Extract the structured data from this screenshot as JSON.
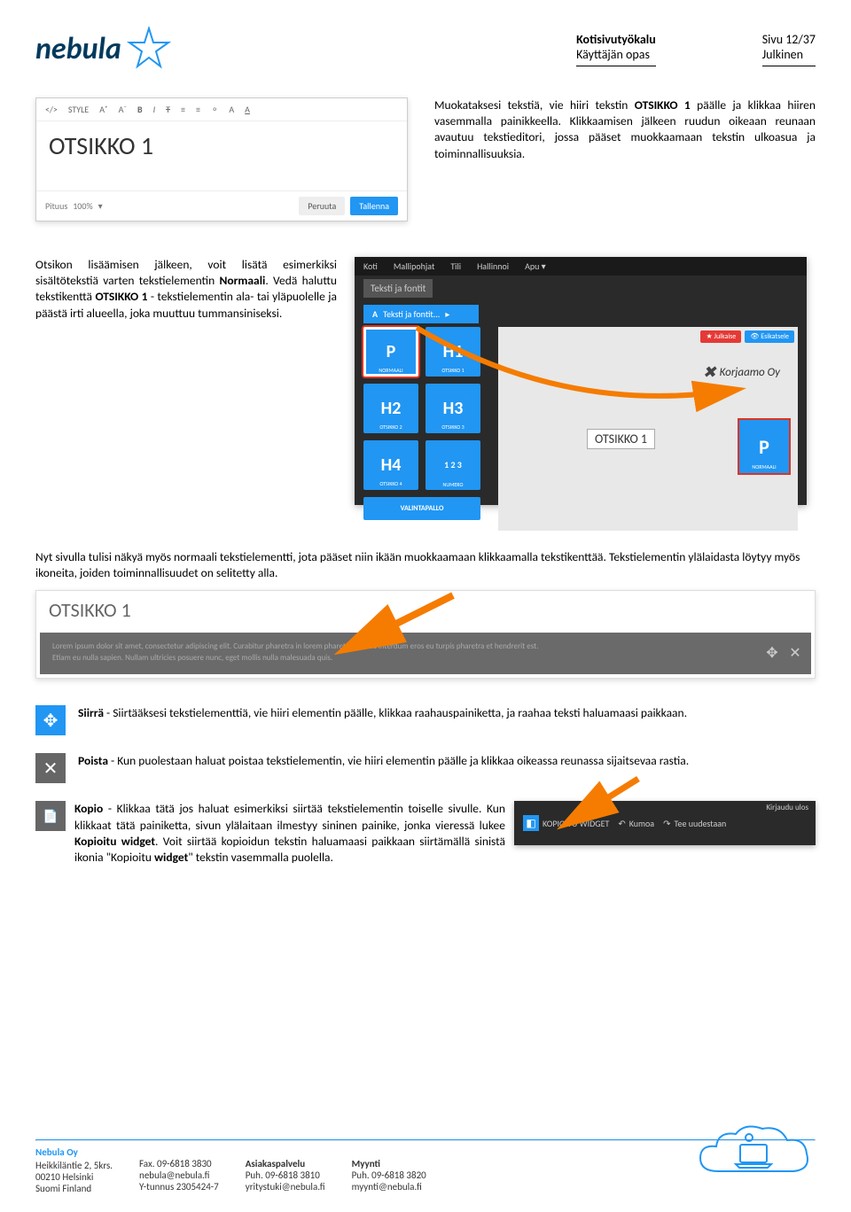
{
  "header": {
    "logo_text": "nebula",
    "doc_title": "Kotisivutyökalu",
    "doc_subtitle": "Käyttäjän opas",
    "page_info": "Sivu 12/37",
    "visibility": "Julkinen"
  },
  "editor": {
    "toolbar": {
      "style": "STYLE",
      "items": [
        "</>",
        "A⁺",
        "A⁻",
        "B",
        "I",
        "T",
        "≡",
        "≡",
        "⚬",
        "A",
        "A"
      ]
    },
    "body": "OTSIKKO 1",
    "length_label": "Pituus",
    "length_value": "100%",
    "cancel": "Peruuta",
    "save": "Tallenna"
  },
  "sec1_text": {
    "p1a": "Muokataksesi tekstiä, vie hiiri tekstin ",
    "p1b": "OTSIKKO 1",
    "p1c": " päälle ja klikkaa hiiren vasemmalla painikkeella. Klikkaamisen jälkeen ruudun oikeaan reunaan avautuu tekstieditori, jossa pääset muokkaamaan tekstin ulkoasua ja toiminnallisuuksia."
  },
  "sec2_text": {
    "p1a": "Otsikon lisäämisen jälkeen, voit lisätä esimerkiksi sisältötekstiä varten tekstielementin ",
    "p1b": "Normaali",
    "p1c": ". Vedä haluttu tekstikenttä ",
    "p1d": "OTSIKKO 1",
    "p1e": " - tekstielementin ala- tai yläpuolelle ja päästä irti alueella, joka muuttuu tummansiniseksi."
  },
  "panel": {
    "nav": [
      "Koti",
      "Mallipohjat",
      "Tili",
      "Hallinnoi",
      "Apu ▾"
    ],
    "tag": "Teksti ja fontit",
    "sidebar_label": "Teksti ja fontit...",
    "tiles": [
      {
        "big": "P",
        "sub": "NORMAALI"
      },
      {
        "big": "H1",
        "sub": "OTSIKKO 1"
      },
      {
        "big": "H2",
        "sub": "OTSIKKO 2"
      },
      {
        "big": "H3",
        "sub": "OTSIKKO 3"
      },
      {
        "big": "H4",
        "sub": "OTSIKKO 4"
      },
      {
        "big": "1 2 3",
        "sub": "NUMERO"
      }
    ],
    "valintapallo": "VALINTAPALLO",
    "preview": {
      "julkaise": "★ Julkaise",
      "esikatsele": "👁 Esikatsele",
      "brand": "Korjaamo Oy",
      "otsikko": "OTSIKKO 1",
      "tile_p_big": "P",
      "tile_p_sub": "NORMAALI"
    }
  },
  "sec3_text": "Nyt sivulla tulisi näkyä myös normaali tekstielementti, jota pääset niin ikään muokkaamaan klikkaamalla tekstikenttää. Tekstielementin ylälaidasta löytyy myös ikoneita, joiden toiminnallisuudet on selitetty alla.",
  "wide": {
    "title": "OTSIKKO 1",
    "lorem1": "Lorem ipsum dolor sit amet, consectetur adipiscing elit. Curabitur pharetra in lorem pharetra. Donec interdum eros eu turpis pharetra et hendrerit est.",
    "lorem2": "Etiam eu nulla sapien. Nullam ultricies posuere nunc, eget mollis nulla malesuada quis."
  },
  "icons": {
    "siirra": {
      "title": "Siirrä",
      "text": " - Siirtääksesi tekstielementtiä, vie hiiri elementin päälle, klikkaa raahauspainiketta, ja raahaa teksti haluamaasi paikkaan."
    },
    "poista": {
      "title": "Poista",
      "text": " - Kun puolestaan haluat poistaa tekstielementin, vie hiiri elementin päälle ja klikkaa oikeassa reunassa sijaitsevaa rastia."
    },
    "kopio": {
      "title": "Kopio",
      "text1": " - Klikkaa tätä jos haluat esimerkiksi siirtää tekstielementin toiselle sivulle. Kun klikkaat tätä painiketta, sivun ylälaitaan ilmestyy sininen painike, jonka vieressä lukee ",
      "quoted": "Kopioitu widget",
      "text2": ". Voit siirtää kopioidun tekstin haluamaasi paikkaan siirtämällä sinistä ikonia \"Kopioitu ",
      "bold2": "widget",
      "text3": "\" tekstin vasemmalla puolella."
    }
  },
  "kopio_img": {
    "logout": "Kirjaudu ulos",
    "chip1": "KOPIOITU WIDGET",
    "chip2": "Kumoa",
    "chip3": "Tee uudestaan"
  },
  "footer": {
    "company": "Nebula Oy",
    "col1": [
      "Heikkiläntie 2, 5krs.",
      "00210 Helsinki",
      "Suomi Finland"
    ],
    "col2": [
      "Fax. 09-6818 3830",
      "nebula@nebula.fi",
      "Y-tunnus 2305424-7"
    ],
    "col3_title": "Asiakaspalvelu",
    "col3": [
      "Puh. 09-6818 3810",
      "yritystuki@nebula.fi"
    ],
    "col4_title": "Myynti",
    "col4": [
      "Puh. 09-6818 3820",
      "myynti@nebula.fi"
    ]
  }
}
